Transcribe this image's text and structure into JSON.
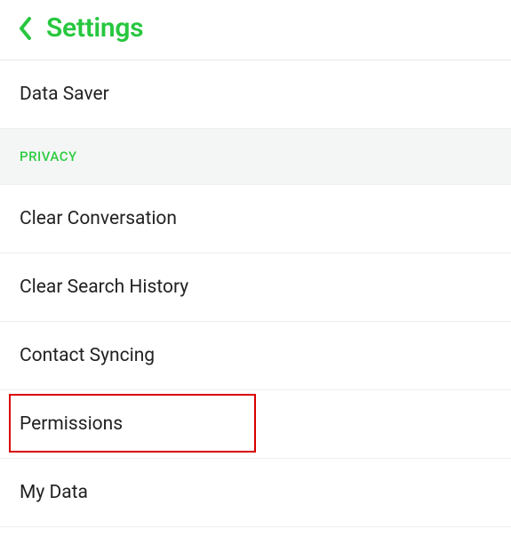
{
  "header": {
    "title": "Settings"
  },
  "items": {
    "data_saver": "Data Saver",
    "clear_conversation": "Clear Conversation",
    "clear_search_history": "Clear Search History",
    "contact_syncing": "Contact Syncing",
    "permissions": "Permissions",
    "my_data": "My Data"
  },
  "sections": {
    "privacy": "PRIVACY"
  }
}
